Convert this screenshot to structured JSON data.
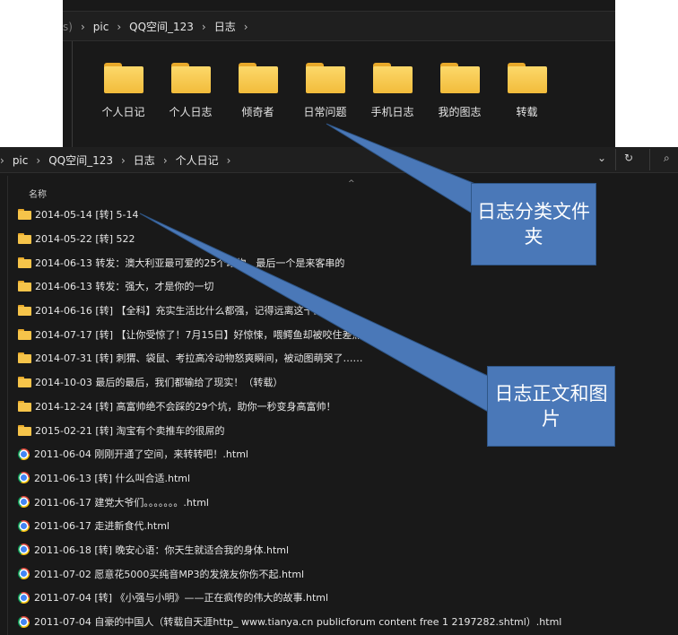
{
  "top_window": {
    "breadcrumb": [
      "s)",
      "pic",
      "QQ空间_123",
      "日志"
    ],
    "folders": [
      "个人日记",
      "个人日志",
      "倾奇者",
      "日常问题",
      "手机日志",
      "我的图志",
      "转载"
    ]
  },
  "bottom_window": {
    "breadcrumb": [
      "pic",
      "QQ空间_123",
      "日志",
      "个人日记"
    ],
    "column_header": "名称",
    "items": [
      {
        "type": "folder",
        "name": "2014-05-14 [转] 5-14"
      },
      {
        "type": "folder",
        "name": "2014-05-22 [转] 522"
      },
      {
        "type": "folder",
        "name": "2014-06-13 转发：澳大利亚最可爱的25个动物，最后一个是来客串的"
      },
      {
        "type": "folder",
        "name": "2014-06-13 转发：强大，才是你的一切"
      },
      {
        "type": "folder",
        "name": "2014-06-16 [转] 【全科】充实生活比什么都强，记得远离这十三种"
      },
      {
        "type": "folder",
        "name": "2014-07-17 [转] 【让你受惊了！7月15日】好惊悚，喂鳄鱼却被咬住差点变成午"
      },
      {
        "type": "folder",
        "name": "2014-07-31 [转] 刺猬、袋鼠、考拉高冷动物怒爽瞬间，被动图萌哭了……"
      },
      {
        "type": "folder",
        "name": "2014-10-03 最后的最后，我们都输给了现实！（转载）"
      },
      {
        "type": "folder",
        "name": "2014-12-24 [转] 高富帅绝不会踩的29个坑，助你一秒变身高富帅！"
      },
      {
        "type": "folder",
        "name": "2015-02-21 [转] 淘宝有个卖推车的很屌的"
      },
      {
        "type": "html",
        "name": "2011-06-04 刚刚开通了空间，来转转吧！.html"
      },
      {
        "type": "html",
        "name": "2011-06-13 [转] 什么叫合适.html"
      },
      {
        "type": "html",
        "name": "2011-06-17 建党大爷们。。。。。。。.html"
      },
      {
        "type": "html",
        "name": "2011-06-17 走进新食代.html"
      },
      {
        "type": "html",
        "name": "2011-06-18 [转] 晚安心语：你天生就适合我的身体.html"
      },
      {
        "type": "html",
        "name": "2011-07-02 愿意花5000买纯音MP3的发烧友你伤不起.html"
      },
      {
        "type": "html",
        "name": "2011-07-04 [转] 《小强与小明》——正在疯传的伟大的故事.html"
      },
      {
        "type": "html",
        "name": "2011-07-04 自豪的中国人（转载自天涯http_ www.tianya.cn publicforum content free 1 2197282.shtml）.html"
      }
    ]
  },
  "callouts": {
    "folders_label": "日志分类文件夹",
    "content_label": "日志正文和图片"
  },
  "icons": {
    "folder": "folder-icon",
    "html": "chrome-html-icon"
  },
  "colors": {
    "background": "#191919",
    "callout": "#4a78b8",
    "folder": "#f6c44a"
  }
}
